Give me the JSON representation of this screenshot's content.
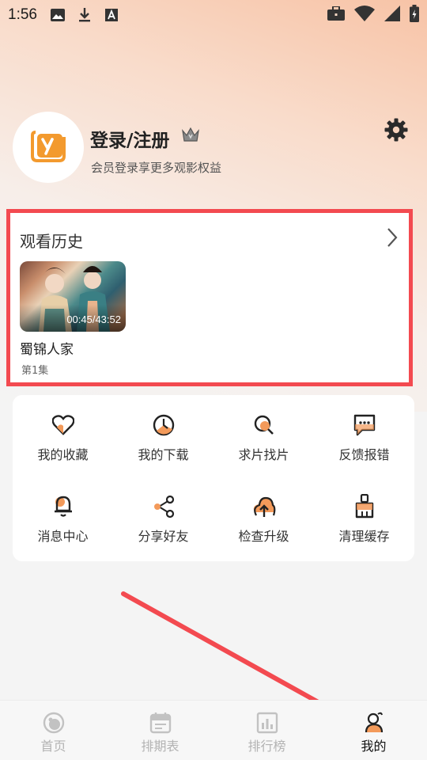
{
  "status_bar": {
    "time": "1:56",
    "icons_left": [
      "image-icon",
      "download-icon",
      "font-icon"
    ],
    "icons_right": [
      "briefcase-icon",
      "wifi-icon",
      "signal-icon",
      "battery-icon"
    ]
  },
  "profile": {
    "title": "登录/注册",
    "subtitle": "会员登录享更多观影权益",
    "avatar_icon": "app-logo-icon",
    "settings_icon": "gear-icon"
  },
  "history": {
    "title": "观看历史",
    "items": [
      {
        "show": "蜀锦人家",
        "episode": "第1集",
        "progress": "00:45/43:52"
      }
    ]
  },
  "quick_actions": [
    {
      "label": "我的收藏",
      "icon": "heart-icon"
    },
    {
      "label": "我的下载",
      "icon": "download-clock-icon"
    },
    {
      "label": "求片找片",
      "icon": "search-icon"
    },
    {
      "label": "反馈报错",
      "icon": "feedback-icon"
    },
    {
      "label": "消息中心",
      "icon": "bell-icon"
    },
    {
      "label": "分享好友",
      "icon": "share-icon"
    },
    {
      "label": "检查升级",
      "icon": "upgrade-icon"
    },
    {
      "label": "清理缓存",
      "icon": "broom-icon"
    }
  ],
  "bottom_nav": [
    {
      "label": "首页",
      "icon": "home-icon",
      "active": false
    },
    {
      "label": "排期表",
      "icon": "calendar-icon",
      "active": false
    },
    {
      "label": "排行榜",
      "icon": "chart-icon",
      "active": false
    },
    {
      "label": "我的",
      "icon": "profile-icon",
      "active": true
    }
  ],
  "colors": {
    "accent": "#f39a5a",
    "highlight_box": "#f34a50",
    "nav_inactive": "#b3b3b3"
  }
}
